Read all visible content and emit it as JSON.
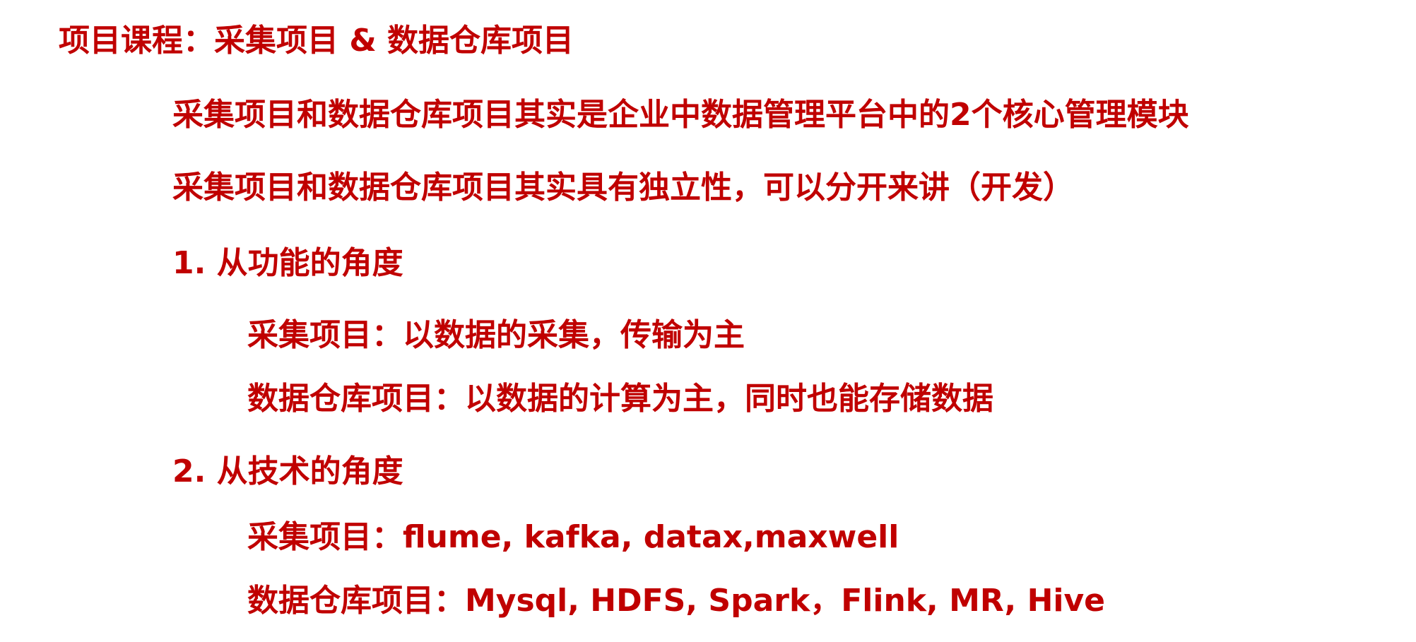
{
  "title": "项目课程：采集项目 & 数据仓库项目",
  "lines": [
    "采集项目和数据仓库项目其实是企业中数据管理平台中的2个核心管理模块",
    "采集项目和数据仓库项目其实具有独立性，可以分开来讲（开发）",
    "1. 从功能的角度",
    "采集项目：以数据的采集，传输为主",
    "数据仓库项目：以数据的计算为主，同时也能存储数据",
    "2. 从技术的角度",
    "采集项目：flume, kafka, datax,maxwell",
    "数据仓库项目：Mysql, HDFS, Spark，Flink, MR, Hive"
  ],
  "colors": {
    "text": "#c00000",
    "background": "#ffffff"
  }
}
